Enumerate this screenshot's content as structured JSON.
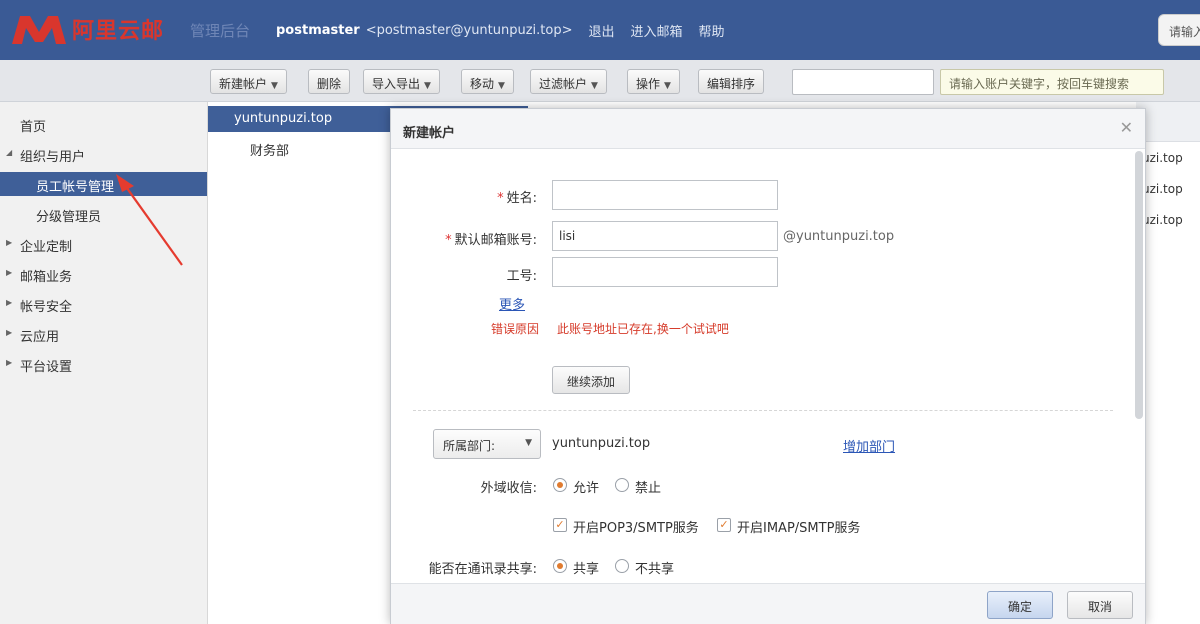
{
  "header": {
    "logo_text": "阿里云邮",
    "sub_brand": "管理后台",
    "username": "postmaster",
    "email": "<postmaster@yuntunpuzi.top>",
    "logout": "退出",
    "enter_mail": "进入邮箱",
    "help": "帮助",
    "search_partial": "请输入"
  },
  "toolbar": {
    "new_account": "新建帐户",
    "delete": "删除",
    "import_export": "导入导出",
    "move": "移动",
    "filter": "过滤帐户",
    "operate": "操作",
    "sort": "编辑排序",
    "search_placeholder": "请输入账户关键字，按回车键搜索"
  },
  "sidebar": {
    "items": [
      {
        "label": "首页"
      },
      {
        "label": "组织与用户"
      },
      {
        "label": "员工帐号管理"
      },
      {
        "label": "分级管理员"
      },
      {
        "label": "企业定制"
      },
      {
        "label": "邮箱业务"
      },
      {
        "label": "帐号安全"
      },
      {
        "label": "云应用"
      },
      {
        "label": "平台设置"
      }
    ]
  },
  "tree": {
    "root": "yuntunpuzi.top",
    "child": "财务部"
  },
  "background_list": {
    "rows": [
      "uzi.top",
      "uzi.top",
      "uzi.top"
    ]
  },
  "modal": {
    "title": "新建帐户",
    "name_label": "姓名:",
    "account_label": "默认邮箱账号:",
    "account_value": "lisi",
    "domain_suffix": "@yuntunpuzi.top",
    "employee_id_label": "工号:",
    "more_link": "更多",
    "error_label": "错误原因",
    "error_msg": "此账号地址已存在,换一个试试吧",
    "continue_add": "继续添加",
    "dept_select": "所属部门:",
    "dept_value": "yuntunpuzi.top",
    "add_dept": "增加部门",
    "external_label": "外域收信:",
    "allow": "允许",
    "deny": "禁止",
    "pop3": "开启POP3/SMTP服务",
    "imap": "开启IMAP/SMTP服务",
    "share_label": "能否在通讯录共享:",
    "share": "共享",
    "no_share": "不共享",
    "ok": "确定",
    "cancel": "取消"
  },
  "colors": {
    "header": "#3a5a95",
    "active": "#3f5f98",
    "error": "#d63b2a",
    "brand_red": "#d9362d"
  }
}
